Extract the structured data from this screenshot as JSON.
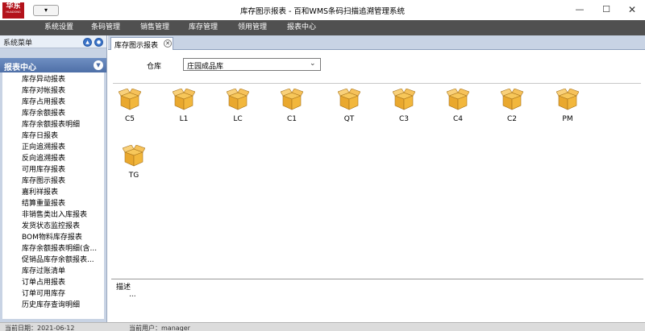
{
  "window": {
    "title": "库存图示报表 - 百和WMS条码扫描追溯管理系统",
    "logo_text": "华东",
    "logo_subtext": "HUADONG",
    "quick_access_icon": "chevron-down-icon",
    "controls": {
      "minimize": "—",
      "maximize": "☐",
      "close": "✕"
    }
  },
  "menubar": {
    "items": [
      {
        "label": "系统设置"
      },
      {
        "label": "条码管理"
      },
      {
        "label": "销售管理"
      },
      {
        "label": "库存管理"
      },
      {
        "label": "领用管理"
      },
      {
        "label": "报表中心"
      }
    ]
  },
  "sidebar": {
    "header": "系统菜单",
    "section_title": "报表中心",
    "items": [
      {
        "label": "库存异动报表"
      },
      {
        "label": "库存对帐报表"
      },
      {
        "label": "库存占用报表"
      },
      {
        "label": "库存余额报表"
      },
      {
        "label": "库存余额报表明细"
      },
      {
        "label": "库存日报表"
      },
      {
        "label": "正向追溯报表"
      },
      {
        "label": "反向追溯报表"
      },
      {
        "label": "可用库存报表"
      },
      {
        "label": "库存图示报表"
      },
      {
        "label": "嘉利祥报表"
      },
      {
        "label": "结算重量报表"
      },
      {
        "label": "非销售类出入库报表"
      },
      {
        "label": "发货状态监控报表"
      },
      {
        "label": "BOM物料库存报表"
      },
      {
        "label": "库存余额报表明细(含..."
      },
      {
        "label": "促销品库存余额报表..."
      },
      {
        "label": "库存过账清单"
      },
      {
        "label": "订单占用报表"
      },
      {
        "label": "订单可用库存"
      },
      {
        "label": "历史库存查询明细"
      }
    ]
  },
  "tabs": [
    {
      "label": "库存图示报表"
    }
  ],
  "warehouse": {
    "label": "仓库",
    "value": "庄园成品库"
  },
  "boxes": [
    {
      "label": "C5"
    },
    {
      "label": "L1"
    },
    {
      "label": "LC"
    },
    {
      "label": "C1"
    },
    {
      "label": "QT"
    },
    {
      "label": "C3"
    },
    {
      "label": "C4"
    },
    {
      "label": "C2"
    },
    {
      "label": "PM"
    },
    {
      "label": "TG"
    }
  ],
  "description": {
    "label": "描述",
    "value": "..."
  },
  "statusbar": {
    "date_text": "当前日期：2021-06-12",
    "user_text": "当前用户：manager"
  },
  "colors": {
    "menubar_bg": "#505050",
    "sidebar_section": "#4e6fa7",
    "box_fill": "#f2b73c"
  }
}
